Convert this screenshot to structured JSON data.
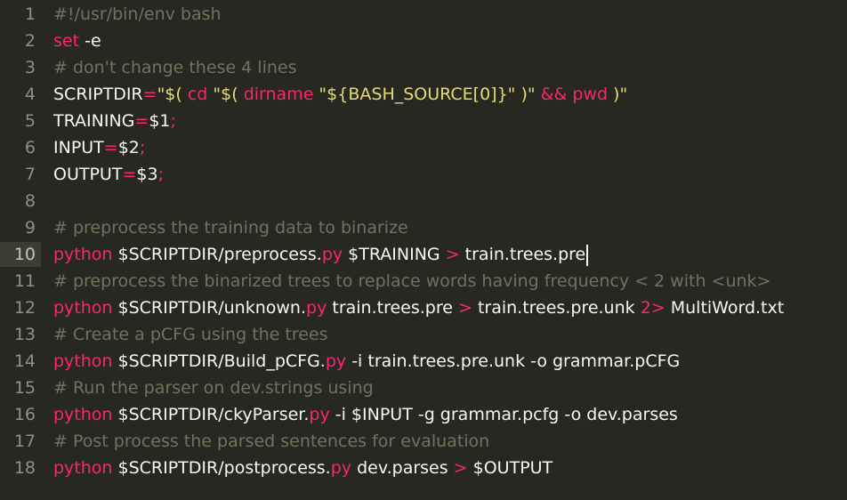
{
  "theme": {
    "background": "#272822",
    "foreground": "#f8f8f2",
    "comment": "#75715e",
    "keyword": "#f92672",
    "string": "#e6db74",
    "gutter": "#90908a",
    "current_line_gutter": "#3e3d32"
  },
  "editor": {
    "current_line": 10,
    "lines": [
      {
        "number": "1",
        "tokens": [
          {
            "t": "comment",
            "v": "#!/usr/bin/env bash"
          }
        ]
      },
      {
        "number": "2",
        "tokens": [
          {
            "t": "keyword",
            "v": "set"
          },
          {
            "t": "plain",
            "v": " -e"
          }
        ]
      },
      {
        "number": "3",
        "tokens": [
          {
            "t": "comment",
            "v": "# don't change these 4 lines"
          }
        ]
      },
      {
        "number": "4",
        "tokens": [
          {
            "t": "plain",
            "v": "SCRIPTDIR"
          },
          {
            "t": "keyword",
            "v": "="
          },
          {
            "t": "string",
            "v": "\"$( "
          },
          {
            "t": "keyword",
            "v": "cd"
          },
          {
            "t": "string",
            "v": " \"$( "
          },
          {
            "t": "keyword",
            "v": "dirname"
          },
          {
            "t": "string",
            "v": " \"${BASH_SOURCE[0]}\" )\" "
          },
          {
            "t": "keyword",
            "v": "&&"
          },
          {
            "t": "string",
            "v": " "
          },
          {
            "t": "keyword",
            "v": "pwd"
          },
          {
            "t": "string",
            "v": " )\""
          }
        ]
      },
      {
        "number": "5",
        "tokens": [
          {
            "t": "plain",
            "v": "TRAINING"
          },
          {
            "t": "keyword",
            "v": "="
          },
          {
            "t": "plain",
            "v": "$1"
          },
          {
            "t": "keyword",
            "v": ";"
          }
        ]
      },
      {
        "number": "6",
        "tokens": [
          {
            "t": "plain",
            "v": "INPUT"
          },
          {
            "t": "keyword",
            "v": "="
          },
          {
            "t": "plain",
            "v": "$2"
          },
          {
            "t": "keyword",
            "v": ";"
          }
        ]
      },
      {
        "number": "7",
        "tokens": [
          {
            "t": "plain",
            "v": "OUTPUT"
          },
          {
            "t": "keyword",
            "v": "="
          },
          {
            "t": "plain",
            "v": "$3"
          },
          {
            "t": "keyword",
            "v": ";"
          }
        ]
      },
      {
        "number": "8",
        "tokens": []
      },
      {
        "number": "9",
        "tokens": [
          {
            "t": "comment",
            "v": "# preprocess the training data to binarize"
          }
        ]
      },
      {
        "number": "10",
        "tokens": [
          {
            "t": "keyword",
            "v": "python"
          },
          {
            "t": "plain",
            "v": " $SCRIPTDIR/preprocess."
          },
          {
            "t": "keyword",
            "v": "py"
          },
          {
            "t": "plain",
            "v": " $TRAINING "
          },
          {
            "t": "keyword",
            "v": ">"
          },
          {
            "t": "plain",
            "v": " train.trees.pre"
          }
        ]
      },
      {
        "number": "11",
        "tokens": [
          {
            "t": "comment",
            "v": "# preprocess the binarized trees to replace words having frequency < 2 with <unk>"
          }
        ]
      },
      {
        "number": "12",
        "tokens": [
          {
            "t": "keyword",
            "v": "python"
          },
          {
            "t": "plain",
            "v": " $SCRIPTDIR/unknown."
          },
          {
            "t": "keyword",
            "v": "py"
          },
          {
            "t": "plain",
            "v": " train.trees.pre "
          },
          {
            "t": "keyword",
            "v": ">"
          },
          {
            "t": "plain",
            "v": " train.trees.pre.unk "
          },
          {
            "t": "keyword",
            "v": "2>"
          },
          {
            "t": "plain",
            "v": " MultiWord.txt"
          }
        ]
      },
      {
        "number": "13",
        "tokens": [
          {
            "t": "comment",
            "v": "# Create a pCFG using the trees"
          }
        ]
      },
      {
        "number": "14",
        "tokens": [
          {
            "t": "keyword",
            "v": "python"
          },
          {
            "t": "plain",
            "v": " $SCRIPTDIR/Build_pCFG."
          },
          {
            "t": "keyword",
            "v": "py"
          },
          {
            "t": "plain",
            "v": " -i train.trees.pre.unk -o grammar.pCFG"
          }
        ]
      },
      {
        "number": "15",
        "tokens": [
          {
            "t": "comment",
            "v": "# Run the parser on dev.strings using"
          }
        ]
      },
      {
        "number": "16",
        "tokens": [
          {
            "t": "keyword",
            "v": "python"
          },
          {
            "t": "plain",
            "v": " $SCRIPTDIR/ckyParser."
          },
          {
            "t": "keyword",
            "v": "py"
          },
          {
            "t": "plain",
            "v": " -i $INPUT -g grammar.pcfg -o dev.parses"
          }
        ]
      },
      {
        "number": "17",
        "tokens": [
          {
            "t": "comment",
            "v": "# Post process the parsed sentences for evaluation"
          }
        ]
      },
      {
        "number": "18",
        "tokens": [
          {
            "t": "keyword",
            "v": "python"
          },
          {
            "t": "plain",
            "v": " $SCRIPTDIR/postprocess."
          },
          {
            "t": "keyword",
            "v": "py"
          },
          {
            "t": "plain",
            "v": " dev.parses "
          },
          {
            "t": "keyword",
            "v": ">"
          },
          {
            "t": "plain",
            "v": " $OUTPUT"
          }
        ]
      }
    ]
  }
}
